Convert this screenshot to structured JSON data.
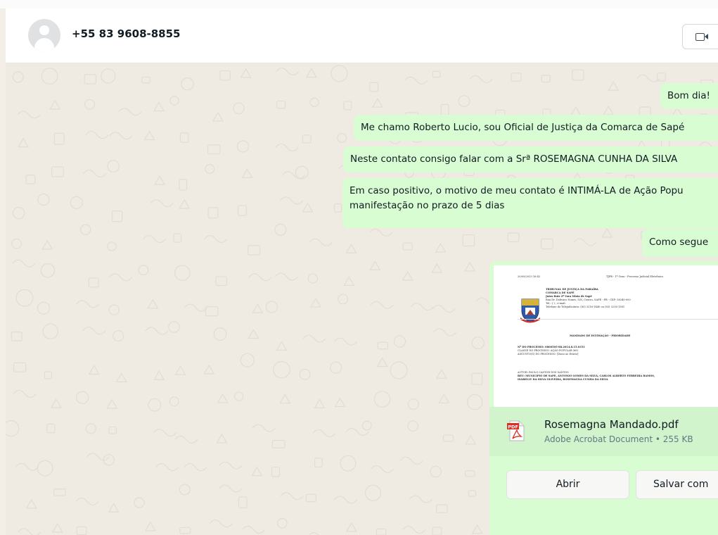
{
  "header": {
    "contact_name": "+55 83 9608-8855",
    "avatar_icon": "default-user-avatar-icon",
    "video_call_icon": "video-camera-icon"
  },
  "messages": [
    {
      "text": "Bom dia!"
    },
    {
      "text": "Me chamo Roberto Lucio, sou Oficial de Justiça da Comarca de Sapé"
    },
    {
      "text": "Neste contato consigo falar com a Srª ROSEMAGNA CUNHA DA SILVA"
    },
    {
      "line1": "Em caso positivo, o motivo de meu contato é INTIMÁ-LA de Ação Popu",
      "line2": "manifestação no prazo de 5 dias"
    },
    {
      "text": "Como segue"
    }
  ],
  "document": {
    "preview": {
      "top_left": "20/09/2023 16:42",
      "top_right": "TJPB - 1º Grau - Processo Judicial Eletrônico",
      "court_name": "TRIBUNAL DE JUSTIÇA DA PARAÍBA",
      "comarca": "COMARCA DE SAPÉ",
      "vara": "Juízo Ruiz 2ª Vara Mista de Sapé",
      "address1": "Rua Dr. Dolivaro Nunes, S/N, Centro, SAPÉ - PB - CEP: 58340-000",
      "address2": "Tel.: ( ) ; e-mail:",
      "address3": "Telefone do Telejudiciário: (83) 3216-1440 ou (83) 3216-1581",
      "doc_title": "MANDADO DE INTIMAÇÃO - PRIORIDADE",
      "process_no": "Nº DO PROCESSO: 0800505-88.2014.8.15.0351",
      "class_line": "CLASSE DO PROCESSO: AÇÃO POPULAR (66)",
      "subject_line": "ASSUNTO(S) DO PROCESSO: [Dano ao Erário]",
      "author_line": "AUTOR: PAULO CASTOR DOS SANTOS",
      "reu_line1": "REU: MUNICIPIO DE SAPE, ANTONIO GOMES DA SILVA, CARLOS ALBERTO FERREIRA RAMOS,",
      "reu_line2": "ISABELLY DA SILVA OLIVEIRA, ROSEMAGNA CUNHA DA SILVA"
    },
    "file_icon": "pdf-file-icon",
    "pdf_badge": "PDF",
    "file_name": "Rosemagna Mandado.pdf",
    "file_meta": "Adobe Acrobat Document • 255 KB",
    "open_label": "Abrir",
    "save_label": "Salvar com"
  },
  "colors": {
    "outgoing_bubble": "#d9fdd3",
    "chat_background": "#efeae2",
    "header_background": "#ffffff"
  }
}
